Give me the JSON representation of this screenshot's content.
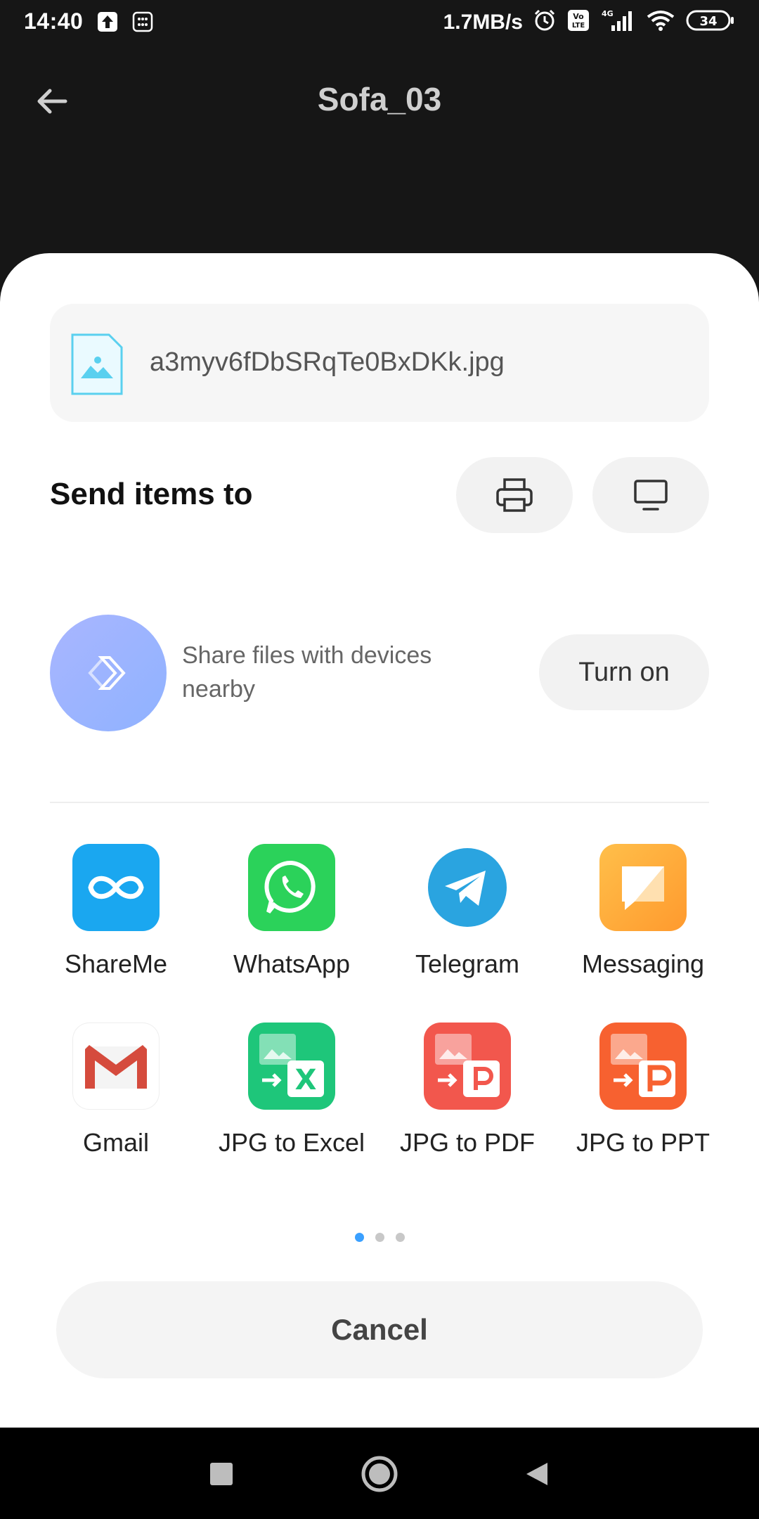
{
  "status_bar": {
    "time": "14:40",
    "net_speed": "1.7MB/s",
    "battery": "34",
    "network": "4G"
  },
  "app_bar": {
    "title": "Sofa_03"
  },
  "share_sheet": {
    "file_name": "a3myv6fDbSRqTe0BxDKk.jpg",
    "send_title": "Send items to",
    "nearby_text": "Share files with devices nearby",
    "turn_on_label": "Turn on",
    "apps": [
      {
        "label": "ShareMe",
        "icon": "shareme-icon"
      },
      {
        "label": "WhatsApp",
        "icon": "whatsapp-icon"
      },
      {
        "label": "Telegram",
        "icon": "telegram-icon"
      },
      {
        "label": "Messaging",
        "icon": "messaging-icon"
      },
      {
        "label": "Gmail",
        "icon": "gmail-icon"
      },
      {
        "label": "JPG to Excel",
        "icon": "jpg-to-excel-icon"
      },
      {
        "label": "JPG to PDF",
        "icon": "jpg-to-pdf-icon"
      },
      {
        "label": "JPG to PPT",
        "icon": "jpg-to-ppt-icon"
      }
    ],
    "page_indicator": {
      "total": 3,
      "active": 1
    },
    "cancel_label": "Cancel"
  },
  "colors": {
    "accent": "#3aa0ff",
    "shareme": "#1aa7f0",
    "whatsapp": "#2bd25a",
    "telegram": "#2aa4e0",
    "messaging": "#ffa53a",
    "excel": "#1ec67a",
    "pdf": "#f2574d",
    "ppt": "#f76130"
  }
}
